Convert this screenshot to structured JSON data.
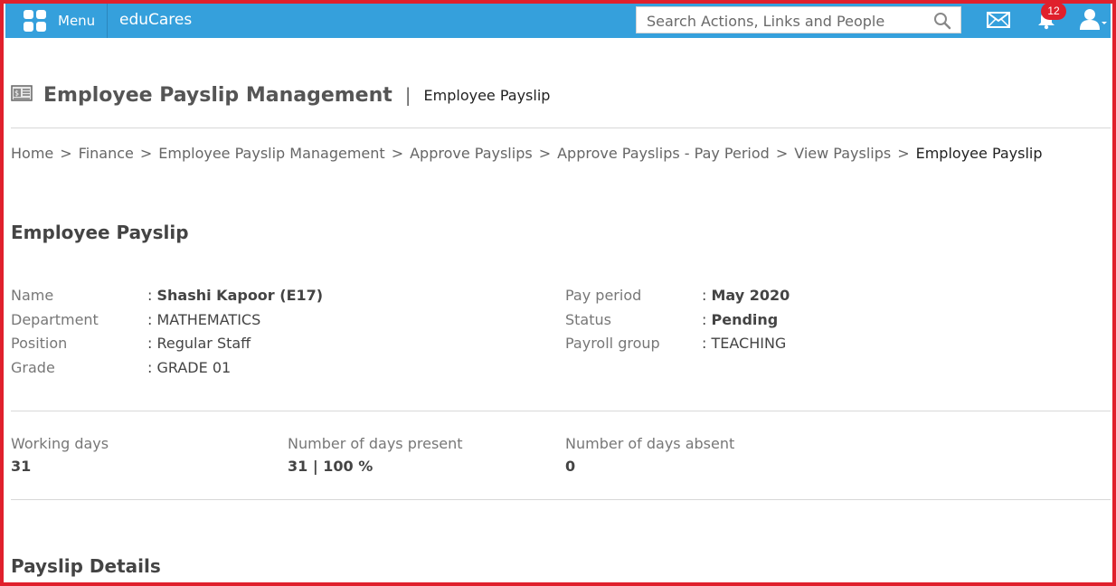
{
  "topbar": {
    "menu_label": "Menu",
    "brand": "eduCares",
    "search_placeholder": "Search Actions, Links and People",
    "notification_count": "12",
    "bar_color": "#35a0dc",
    "badge_color": "#e0202c"
  },
  "header": {
    "title": "Employee Payslip Management",
    "separator": "|",
    "subtitle": "Employee Payslip"
  },
  "breadcrumb": {
    "separator": ">",
    "links": [
      "Home",
      "Finance",
      "Employee Payslip Management",
      "Approve Payslips",
      "Approve Payslips - Pay Period",
      "View Payslips"
    ],
    "current": "Employee Payslip"
  },
  "employee": {
    "section_title": "Employee Payslip",
    "colon": ":",
    "left": [
      {
        "label": "Name",
        "value": "Shashi Kapoor (E17)",
        "bold": true
      },
      {
        "label": "Department",
        "value": "MATHEMATICS",
        "bold": false
      },
      {
        "label": "Position",
        "value": "Regular Staff",
        "bold": false
      },
      {
        "label": "Grade",
        "value": "GRADE 01",
        "bold": false
      }
    ],
    "right": [
      {
        "label": "Pay period",
        "value": "May 2020",
        "bold": true
      },
      {
        "label": "Status",
        "value": "Pending",
        "bold": true
      },
      {
        "label": "Payroll group",
        "value": "TEACHING",
        "bold": false
      }
    ]
  },
  "attendance": {
    "working_days_label": "Working days",
    "working_days_value": "31",
    "present_label": "Number of days present",
    "present_value": "31 | 100 %",
    "absent_label": "Number of days absent",
    "absent_value": "0"
  },
  "details": {
    "section_title": "Payslip Details"
  }
}
